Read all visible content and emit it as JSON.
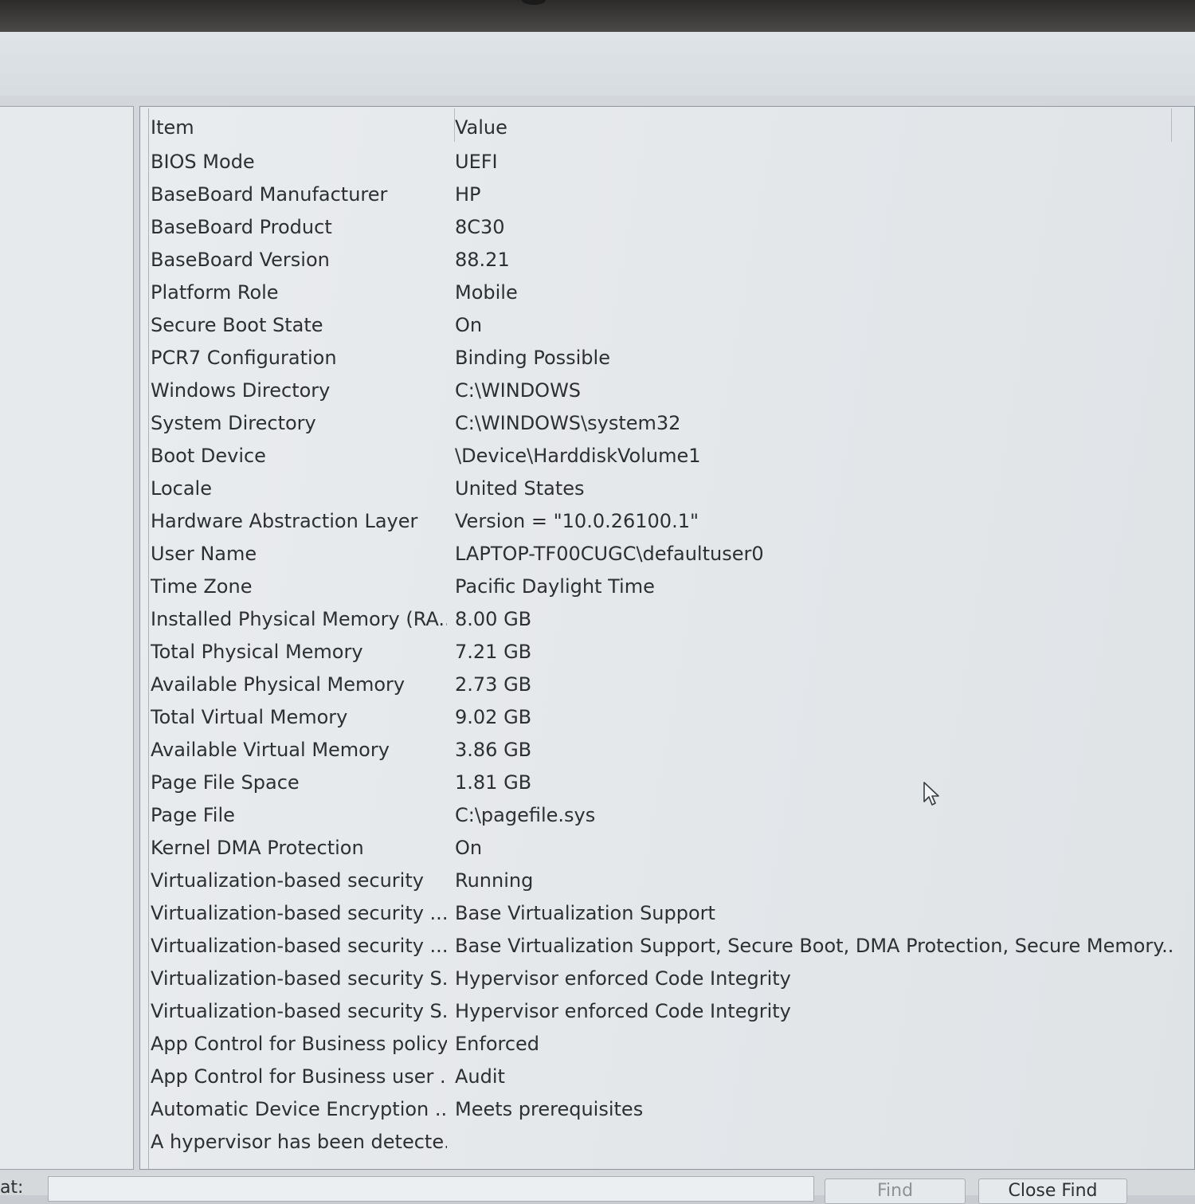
{
  "table": {
    "columns": {
      "item": "Item",
      "value": "Value"
    },
    "rows": [
      {
        "item": "BIOS Mode",
        "value": "UEFI"
      },
      {
        "item": "BaseBoard Manufacturer",
        "value": "HP"
      },
      {
        "item": "BaseBoard Product",
        "value": "8C30"
      },
      {
        "item": "BaseBoard Version",
        "value": "88.21"
      },
      {
        "item": "Platform Role",
        "value": "Mobile"
      },
      {
        "item": "Secure Boot State",
        "value": "On"
      },
      {
        "item": "PCR7 Configuration",
        "value": "Binding Possible"
      },
      {
        "item": "Windows Directory",
        "value": "C:\\WINDOWS"
      },
      {
        "item": "System Directory",
        "value": "C:\\WINDOWS\\system32"
      },
      {
        "item": "Boot Device",
        "value": "\\Device\\HarddiskVolume1"
      },
      {
        "item": "Locale",
        "value": "United States"
      },
      {
        "item": "Hardware Abstraction Layer",
        "value": "Version = \"10.0.26100.1\""
      },
      {
        "item": "User Name",
        "value": "LAPTOP-TF00CUGC\\defaultuser0"
      },
      {
        "item": "Time Zone",
        "value": "Pacific Daylight Time"
      },
      {
        "item": "Installed Physical Memory (RA...",
        "value": "8.00 GB"
      },
      {
        "item": "Total Physical Memory",
        "value": "7.21 GB"
      },
      {
        "item": "Available Physical Memory",
        "value": "2.73 GB"
      },
      {
        "item": "Total Virtual Memory",
        "value": "9.02 GB"
      },
      {
        "item": "Available Virtual Memory",
        "value": "3.86 GB"
      },
      {
        "item": "Page File Space",
        "value": "1.81 GB"
      },
      {
        "item": "Page File",
        "value": "C:\\pagefile.sys"
      },
      {
        "item": "Kernel DMA Protection",
        "value": "On"
      },
      {
        "item": "Virtualization-based security",
        "value": "Running"
      },
      {
        "item": "Virtualization-based security ...",
        "value": "Base Virtualization Support"
      },
      {
        "item": "Virtualization-based security ...",
        "value": "Base Virtualization Support, Secure Boot, DMA Protection, Secure Memory..."
      },
      {
        "item": "Virtualization-based security S...",
        "value": "Hypervisor enforced Code Integrity"
      },
      {
        "item": "Virtualization-based security S...",
        "value": "Hypervisor enforced Code Integrity"
      },
      {
        "item": "App Control for Business policy",
        "value": "Enforced"
      },
      {
        "item": "App Control for Business user ...",
        "value": "Audit"
      },
      {
        "item": "Automatic Device Encryption ...",
        "value": "Meets prerequisites"
      },
      {
        "item": "A hypervisor has been detecte...",
        "value": ""
      }
    ]
  },
  "find_bar": {
    "label": "hat:",
    "find_button": "Find",
    "close_find_button": "Close Find"
  },
  "icons": {
    "cursor": "mouse-pointer-icon"
  }
}
